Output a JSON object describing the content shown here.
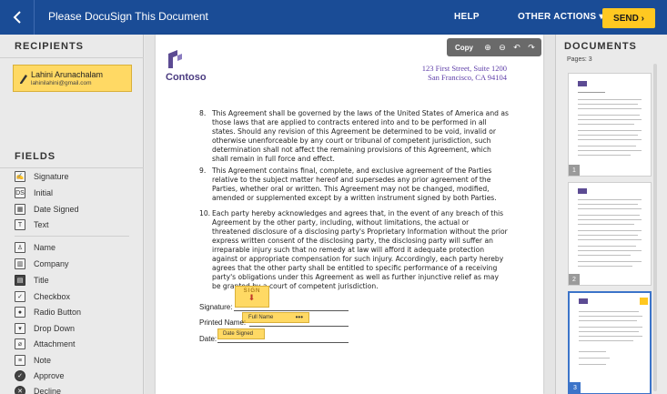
{
  "header": {
    "title": "Please DocuSign This Document",
    "help": "HELP",
    "other_actions": "OTHER ACTIONS ▾",
    "send": "SEND ›"
  },
  "recipients": {
    "heading": "RECIPIENTS",
    "items": [
      {
        "name": "Lahini Arunachalam",
        "email": "lahinilahini@gmail.com"
      }
    ]
  },
  "fields": {
    "heading": "FIELDS",
    "items": [
      {
        "label": "Signature",
        "icon": "signature-icon"
      },
      {
        "label": "Initial",
        "icon": "initial-icon"
      },
      {
        "label": "Date Signed",
        "icon": "calendar-icon"
      },
      {
        "label": "Text",
        "icon": "text-icon"
      },
      {
        "label": "Name",
        "icon": "person-icon"
      },
      {
        "label": "Company",
        "icon": "company-icon"
      },
      {
        "label": "Title",
        "icon": "title-icon"
      },
      {
        "label": "Checkbox",
        "icon": "checkbox-icon"
      },
      {
        "label": "Radio Button",
        "icon": "radio-icon"
      },
      {
        "label": "Drop Down",
        "icon": "dropdown-icon"
      },
      {
        "label": "Attachment",
        "icon": "attachment-icon"
      },
      {
        "label": "Note",
        "icon": "note-icon"
      },
      {
        "label": "Approve",
        "icon": "approve-icon"
      },
      {
        "label": "Decline",
        "icon": "decline-icon"
      }
    ]
  },
  "toolbar": {
    "copy": "Copy"
  },
  "document": {
    "company": "Contoso",
    "address_line1": "123 First Street, Suite 1200",
    "address_line2": "San Francisco, CA 94104",
    "clauses": [
      {
        "num": "8.",
        "text": "This Agreement shall be governed by the laws of the United States of America and as those laws that are applied to contracts entered into and to be performed in all states. Should any revision of this Agreement be determined to be void, invalid or otherwise unenforceable by any court or tribunal of competent jurisdiction, such determination shall not affect the remaining provisions of this Agreement, which shall remain in full force and effect."
      },
      {
        "num": "9.",
        "text": "This Agreement contains final, complete, and exclusive agreement of the Parties relative to the subject matter hereof and supersedes any prior agreement of the Parties, whether oral or written. This Agreement may not be changed, modified, amended or supplemented except by a written instrument signed by both Parties."
      },
      {
        "num": "10.",
        "text": "Each party hereby acknowledges and agrees that, in the event of any breach of this Agreement by the other party, including, without limitations, the actual or threatened disclosure of a disclosing party's Proprietary Information without the prior express written consent of the disclosing party, the disclosing party will suffer an irreparable injury such that no remedy at law will afford it adequate protection against or appropriate compensation for such injury. Accordingly, each party hereby agrees that the other party shall be entitled to specific performance of a receiving party's obligations under this Agreement as well as further injunctive relief as may be granted by a court of competent jurisdiction."
      }
    ],
    "signature_label": "Signature:",
    "printed_name_label": "Printed Name:",
    "date_label": "Date:",
    "sign_tag": "SIGN",
    "fullname_tag": "Full Name",
    "fullname_dots": "•••",
    "date_tag": "Date Signed"
  },
  "documents_panel": {
    "heading": "DOCUMENTS",
    "pages": "Pages: 3",
    "thumbs": [
      {
        "num": "1"
      },
      {
        "num": "2"
      },
      {
        "num": "3"
      }
    ]
  }
}
